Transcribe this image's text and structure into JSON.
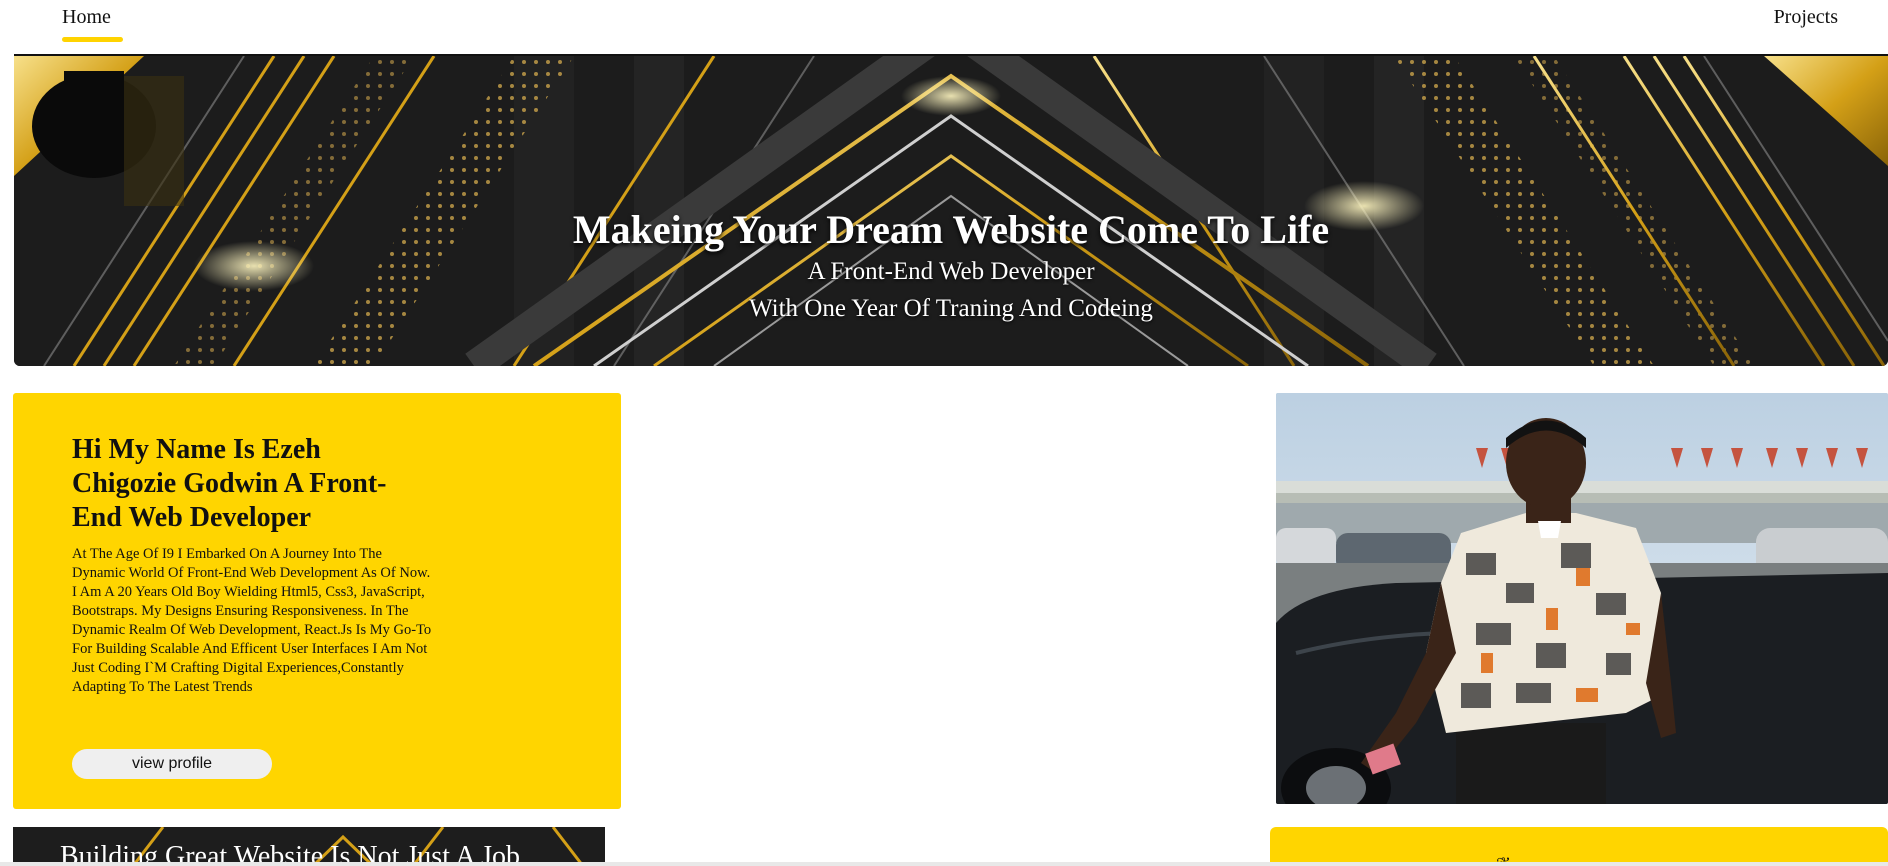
{
  "nav": {
    "home_label": "Home",
    "projects_label": "Projects"
  },
  "hero": {
    "title": "Makeing Your Dream Website Come To Life",
    "subtitle_line1": "A Front-End Web Developer",
    "subtitle_line2": "With One Year Of Traning And Codeing"
  },
  "intro": {
    "heading": "Hi My Name Is Ezeh Chigozie Godwin A Front-End Web Developer",
    "body": "At The Age Of I9 I Embarked On A Journey Into The Dynamic World Of Front-End Web Development As Of Now. I Am A 20 Years Old Boy Wielding Html5, Css3, JavaScript, Bootstraps. My Designs Ensuring Responsiveness. In The Dynamic Realm Of Web Development, React.Js Is My Go-To For Building Scalable And Efficent User Interfaces I Am Not Just Coding I`M Crafting Digital Experiences,Constantly Adapting To The Latest Trends",
    "button_label": "view profile"
  },
  "banner2": {
    "text": "Building Great Website Is Not Just A Job"
  },
  "colors": {
    "accent": "#FFD500",
    "hero_bg": "#1c1c1c",
    "gold": "#D4A017"
  }
}
